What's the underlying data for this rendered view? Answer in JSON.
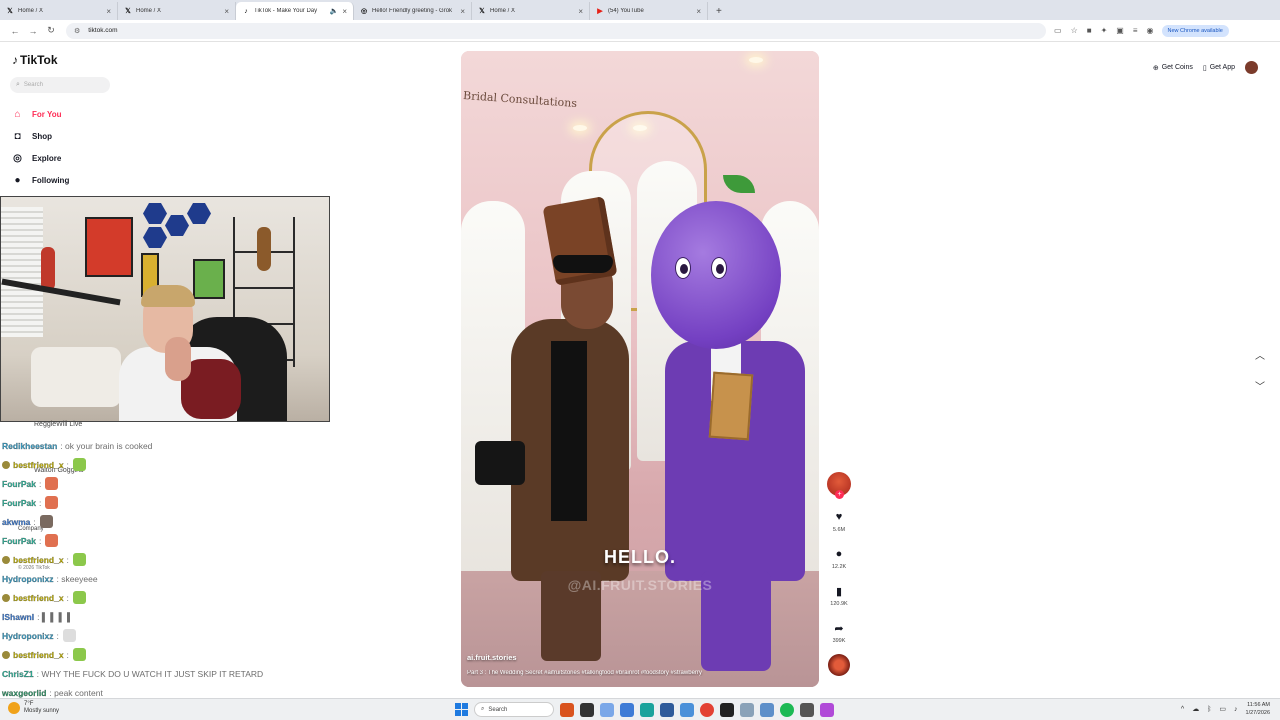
{
  "browser": {
    "tabs": [
      {
        "label": "Home / X",
        "icon": "x-icon",
        "active": false
      },
      {
        "label": "Home / X",
        "icon": "x-icon",
        "active": false
      },
      {
        "label": "TikTok - Make Your Day",
        "icon": "tiktok-icon",
        "active": true
      },
      {
        "label": "Hello! Friendly greeting - Grok",
        "icon": "grok-icon",
        "active": false
      },
      {
        "label": "Home / X",
        "icon": "x-icon",
        "active": false
      },
      {
        "label": "(54) YouTube",
        "icon": "youtube-icon",
        "active": false
      }
    ],
    "url": "tiktok.com",
    "update_pill": "New Chrome available"
  },
  "tiktok": {
    "logo": "TikTok",
    "search_placeholder": "Search",
    "nav": [
      {
        "label": "For You",
        "icon": "home-icon",
        "active": true
      },
      {
        "label": "Shop",
        "icon": "shop-bag-icon",
        "active": false
      },
      {
        "label": "Explore",
        "icon": "compass-icon",
        "active": false
      },
      {
        "label": "Following",
        "icon": "following-icon",
        "active": false
      }
    ],
    "get_coins": "Get Coins",
    "get_app": "Get App",
    "accent": "#fe2c55"
  },
  "video": {
    "sign_text": "Bridal Consultations",
    "caption": "HELLO.",
    "watermark": "@AI.FRUIT.STORIES",
    "author": "ai.fruit.stories",
    "description": "Part 3 : The Wedding Secret #aifruitstories #talkingfood #brainrot #foodstory #strawberry",
    "likes": "5.6M",
    "comments": "12.2K",
    "saves": "120.9K",
    "shares": "399K"
  },
  "chat": {
    "ghost_texts": [
      "ReggieWill Live",
      "Walton Goggins",
      "Company",
      "© 2026 TikTok"
    ],
    "lines": [
      {
        "user": "Redikheestan",
        "color": "#3aa0c8",
        "msg": ": ok your brain is cooked",
        "badge": false,
        "emote": ""
      },
      {
        "user": "bestfriend_x",
        "color": "#c8b800",
        "msg": ":",
        "badge": true,
        "emote": "#8cc84b"
      },
      {
        "user": "FourPak",
        "color": "#2fb39a",
        "msg": ":",
        "badge": false,
        "emote": "#e07050"
      },
      {
        "user": "FourPak",
        "color": "#2fb39a",
        "msg": ":",
        "badge": false,
        "emote": "#e07050"
      },
      {
        "user": "akwma",
        "color": "#3a7bd5",
        "msg": ":",
        "badge": false,
        "emote": "#7a6a60"
      },
      {
        "user": "FourPak",
        "color": "#2fb39a",
        "msg": ":",
        "badge": false,
        "emote": "#e07050"
      },
      {
        "user": "bestfriend_x",
        "color": "#c8b800",
        "msg": ":",
        "badge": true,
        "emote": "#8cc84b"
      },
      {
        "user": "Hydroponixz",
        "color": "#3aa0c8",
        "msg": ": skeeyeee",
        "badge": false,
        "emote": ""
      },
      {
        "user": "bestfriend_x",
        "color": "#c8b800",
        "msg": ":",
        "badge": true,
        "emote": "#8cc84b"
      },
      {
        "user": "IShawnI",
        "color": "#3a7bd5",
        "msg": ": ▌ ▌ ▌ ▌",
        "badge": false,
        "emote": ""
      },
      {
        "user": "Hydroponixz",
        "color": "#3aa0c8",
        "msg": ":",
        "badge": false,
        "emote": "#ddd"
      },
      {
        "user": "bestfriend_x",
        "color": "#c8b800",
        "msg": ":",
        "badge": true,
        "emote": "#8cc84b"
      },
      {
        "user": "ChrisZ1",
        "color": "#2fb39a",
        "msg": ": WHY THE FUCK DO U WATCH IT JUST SKIP IT RETARD",
        "badge": false,
        "emote": ""
      },
      {
        "user": "waxgeorlid",
        "color": "#2f9a6a",
        "msg": ": peak content",
        "badge": false,
        "emote": ""
      }
    ]
  },
  "taskbar": {
    "weather_temp": "7°F",
    "weather_desc": "Mostly sunny",
    "search_label": "Search",
    "time": "11:56 AM",
    "date": "1/27/2026"
  }
}
